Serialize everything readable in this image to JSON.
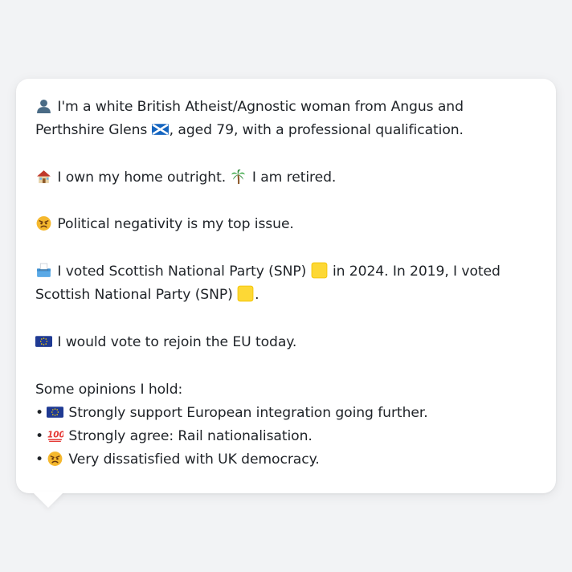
{
  "profile": {
    "line1_text_a": "I'm a white British Atheist/Agnostic woman from Angus and Perthshire Glens",
    "line1_text_b": ", aged 79, with a professional qualification.",
    "home_text": "I own my home outright.",
    "retired_text": "I am retired.",
    "issue_text": "Political negativity is my top issue.",
    "vote_text_a": "I voted Scottish National Party (SNP)",
    "vote_text_b": "in 2024. In 2019, I voted Scottish National Party (SNP)",
    "vote_text_c": ".",
    "eu_text": "I would vote to rejoin the EU today.",
    "opinions_heading": "Some opinions I hold:",
    "opinions": [
      {
        "bullet": "•",
        "text": "Strongly support European integration going further."
      },
      {
        "bullet": "•",
        "text": "Strongly agree: Rail nationalisation."
      },
      {
        "bullet": "•",
        "text": "Very dissatisfied with UK democracy."
      }
    ]
  },
  "icons": {
    "person": "bust-in-silhouette-icon",
    "flag": "scotland-flag-icon",
    "home": "house-icon",
    "retired": "palm-tree-icon",
    "issue": "angry-face-icon",
    "ballot": "ballot-box-icon",
    "party": "yellow-square-icon",
    "eu": "eu-flag-icon",
    "hundred": "hundred-points-icon"
  },
  "colors": {
    "background": "#f2f3f5",
    "bubble": "#ffffff",
    "text": "#1f2328",
    "snp_yellow": "#fdd835",
    "eu_blue": "#1f3a93",
    "scotland_blue": "#1565c0"
  }
}
